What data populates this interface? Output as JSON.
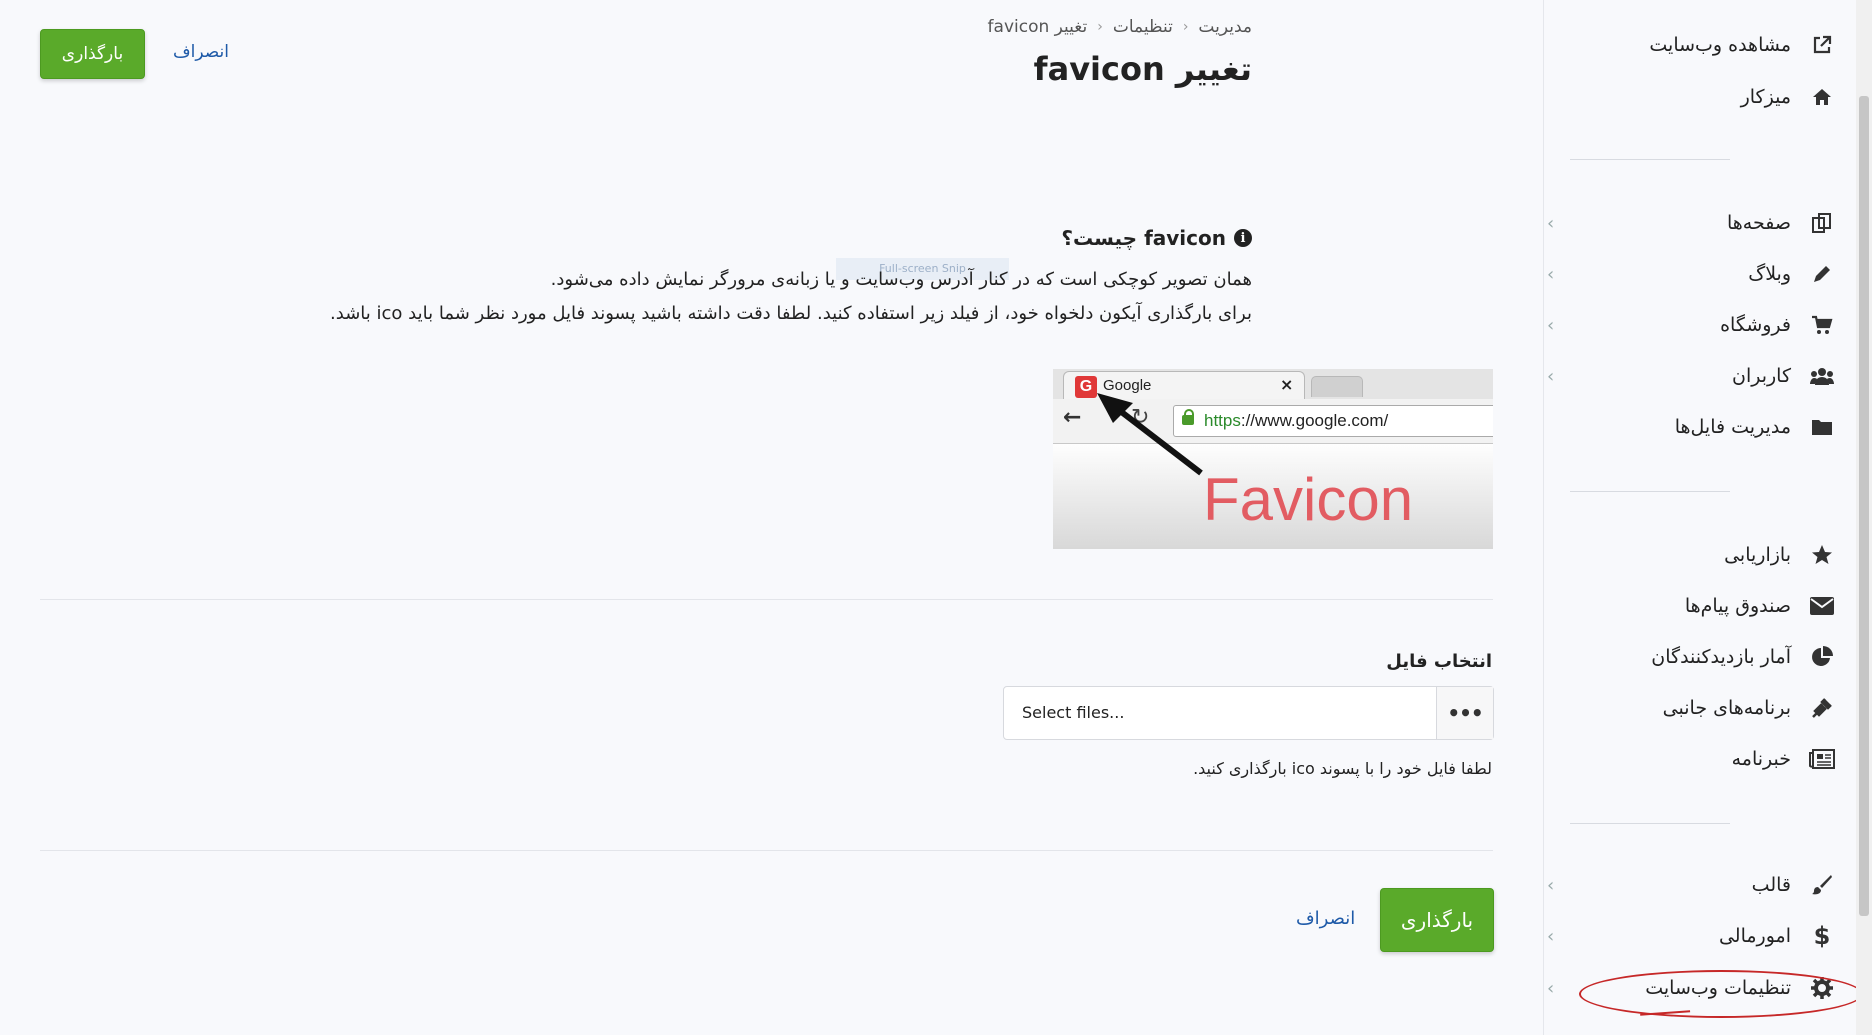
{
  "header": {
    "upload_button": "بارگذاری",
    "cancel_link": "انصراف"
  },
  "breadcrumb": {
    "items": [
      "مدیریت",
      "تنظیمات",
      "تغییر favicon"
    ]
  },
  "page_title": "تغییر favicon",
  "info": {
    "heading": "favicon چیست؟",
    "line1": "همان تصویر کوچکی است که در کنار آدرس وب‌سایت و یا زبانه‌ی مرورگر نمایش داده می‌شود.",
    "line2": "برای بارگذاری آیکون دلخواه خود، از فیلد زیر استفاده کنید. لطفا دقت داشته باشید پسوند فایل مورد نظر شما باید ico باشد.",
    "snip_overlay": "Full-screen Snip"
  },
  "illustration": {
    "tab_title": "Google",
    "url_https": "https",
    "url_rest": "://www.google.com/",
    "favicon_word": "Favicon"
  },
  "file_field": {
    "label": "انتخاب فایل",
    "placeholder": "Select files...",
    "browse": "•••",
    "help": "لطفا فایل خود را با پسوند ico بارگذاری کنید."
  },
  "footer": {
    "upload_button": "بارگذاری",
    "cancel_link": "انصراف"
  },
  "sidebar": {
    "view_site": "مشاهده وب‌سایت",
    "dashboard": "میزکار",
    "pages": "صفحه‌ها",
    "blog": "وبلاگ",
    "shop": "فروشگاه",
    "users": "کاربران",
    "files": "مدیریت فایل‌ها",
    "marketing": "بازاریابی",
    "inbox": "صندوق پیام‌ها",
    "stats": "آمار بازدیدکنندگان",
    "plugins": "برنامه‌های جانبی",
    "newsletter": "خبرنامه",
    "theme": "قالب",
    "finance": "امورمالی",
    "settings": "تنظیمات وب‌سایت"
  },
  "colors": {
    "accent_green": "#5aaa2a",
    "link_blue": "#1e5aa8",
    "annotation_red": "#c62828"
  }
}
